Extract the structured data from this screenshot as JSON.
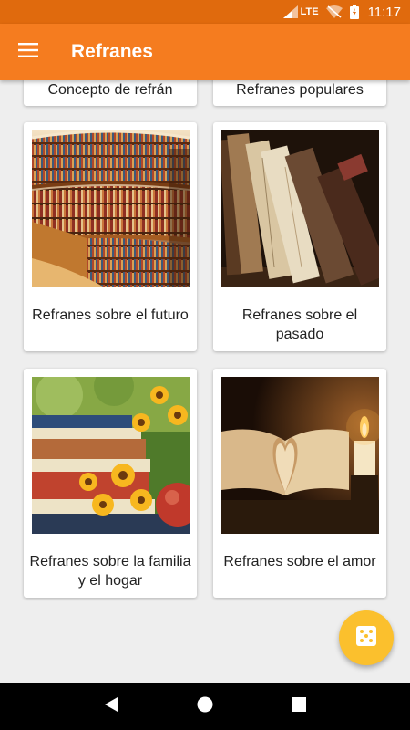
{
  "status_bar": {
    "network": "LTE",
    "time": "11:17"
  },
  "app_bar": {
    "title": "Refranes",
    "menu_icon": "hamburger-menu-icon"
  },
  "categories": [
    {
      "label": "Concepto de refrán"
    },
    {
      "label": "Refranes populares"
    },
    {
      "label": "Refranes sobre el futuro",
      "image": "library-bookshelves"
    },
    {
      "label": "Refranes sobre el pasado",
      "image": "old-books"
    },
    {
      "label": "Refranes sobre la familia y el hogar",
      "image": "books-and-sunflowers"
    },
    {
      "label": "Refranes sobre el amor",
      "image": "open-book-heart-candle"
    }
  ],
  "fab": {
    "icon": "dice-icon"
  },
  "nav": {
    "back": "back-icon",
    "home": "home-icon",
    "recents": "recents-icon"
  },
  "colors": {
    "status_bar": "#e06a0d",
    "app_bar": "#f57c1f",
    "fab": "#fbc02d",
    "background": "#eeeeee"
  }
}
